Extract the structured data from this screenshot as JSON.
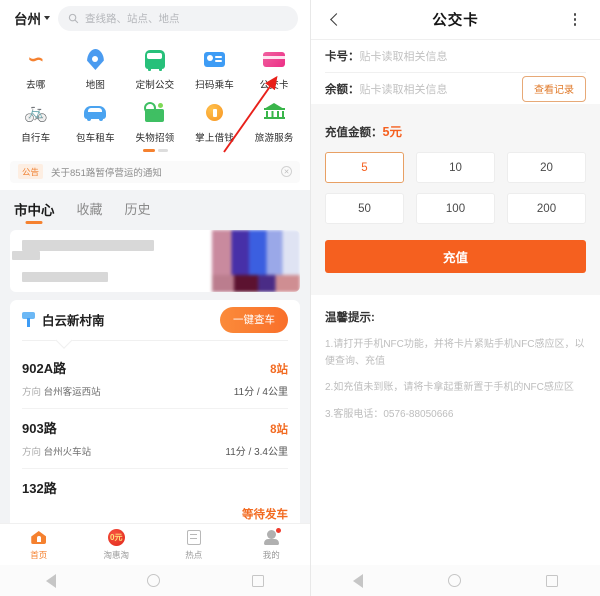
{
  "left_app": {
    "topbar": {
      "city": "台州",
      "city_icon": "chevron-down-icon",
      "search_icon": "search-icon",
      "search_placeholder": "查线路、站点、地点"
    },
    "icon_grid": {
      "row1": [
        {
          "label": "去哪",
          "icon": "route-icon",
          "color": "#f5812f"
        },
        {
          "label": "地图",
          "icon": "map-pin-icon",
          "color": "#4a9bf0"
        },
        {
          "label": "定制公交",
          "icon": "bus-icon",
          "color": "#27c07a"
        },
        {
          "label": "扫码乘车",
          "icon": "scan-ticket-icon",
          "color": "#3e9cf5"
        },
        {
          "label": "公交卡",
          "icon": "bus-card-icon",
          "color": "#ec2f86"
        }
      ],
      "row2": [
        {
          "label": "自行车",
          "icon": "bicycle-icon",
          "color": "#3e9cf5"
        },
        {
          "label": "包车租车",
          "icon": "car-rental-icon",
          "color": "#4aa3f0"
        },
        {
          "label": "失物招领",
          "icon": "lost-and-found-icon",
          "color": "#3fbf63"
        },
        {
          "label": "掌上借钱",
          "icon": "loan-coin-icon",
          "color": "#f79421"
        },
        {
          "label": "旅游服务",
          "icon": "bank-icon",
          "color": "#39b54a"
        }
      ]
    },
    "notice": {
      "badge": "公告",
      "text": "关于851路暂停营运的通知",
      "close_icon": "close-icon"
    },
    "tabs": [
      {
        "label": "市中心",
        "active": true
      },
      {
        "label": "收藏",
        "active": false
      },
      {
        "label": "历史",
        "active": false
      }
    ],
    "ad_banner": {
      "description": "blurred-advertisement-banner"
    },
    "stop_card": {
      "pin_icon": "bus-stop-icon",
      "stop_name": "白云新村南",
      "check_button": "一键查车",
      "routes": [
        {
          "name": "902A路",
          "stops": "8站",
          "direction_label": "方向",
          "direction": "台州客运西站",
          "eta": "11分 / 4公里",
          "status": ""
        },
        {
          "name": "903路",
          "stops": "8站",
          "direction_label": "方向",
          "direction": "台州火车站",
          "eta": "11分 / 3.4公里",
          "status": ""
        },
        {
          "name": "132路",
          "stops": "",
          "direction_label": "",
          "direction": "",
          "eta": "",
          "status": "等待发车"
        }
      ]
    },
    "tabbar": [
      {
        "label": "首页",
        "icon": "home-icon",
        "active": true,
        "badge": ""
      },
      {
        "label": "淘惠淘",
        "icon": "zero-yuan-icon",
        "active": false,
        "badge": "0元"
      },
      {
        "label": "热点",
        "icon": "hotspot-icon",
        "active": false,
        "badge": ""
      },
      {
        "label": "我的",
        "icon": "profile-icon",
        "active": false,
        "badge": "dot"
      }
    ],
    "android_nav": {
      "back": "back-triangle-icon",
      "home": "home-circle-icon",
      "recents": "recents-square-icon"
    }
  },
  "right_app": {
    "header": {
      "back_icon": "back-chevron-icon",
      "title": "公交卡",
      "more_icon": "more-vertical-icon"
    },
    "info": [
      {
        "key": "卡号：",
        "value": "贴卡读取相关信息"
      },
      {
        "key": "余额：",
        "value": "贴卡读取相关信息",
        "action": "查看记录"
      }
    ],
    "amount": {
      "title_prefix": "充值金额：",
      "title_value": "5元",
      "options": [
        "5",
        "10",
        "20",
        "50",
        "100",
        "200"
      ],
      "selected": "5",
      "recharge_button": "充值"
    },
    "tips": {
      "heading": "温馨提示:",
      "items": [
        "1.请打开手机NFC功能，并将卡片紧贴手机NFC感应区，以便查询、充值",
        "2.如充值未到账，请将卡拿起重新置于手机的NFC感应区",
        "3.客服电话：0576-88050666"
      ]
    },
    "android_nav": {
      "back": "back-triangle-icon",
      "home": "home-circle-icon",
      "recents": "recents-square-icon"
    }
  },
  "annotation": {
    "type": "red-arrow",
    "points_to": "公交卡",
    "color": "#e8201a"
  },
  "theme": {
    "accent": "#f5601f",
    "orange": "#f5812f",
    "bg": "#f2f3f5",
    "card": "#ffffff"
  }
}
